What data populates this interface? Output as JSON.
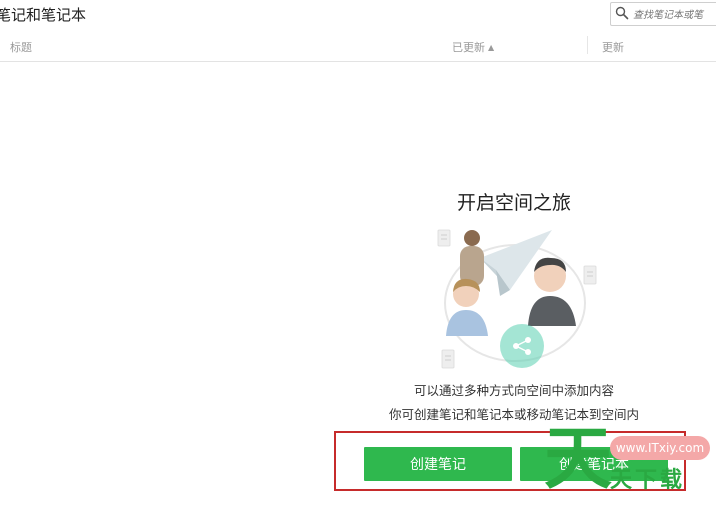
{
  "header": {
    "title": "笔记和笔记本",
    "search_placeholder": "查找笔记本或笔"
  },
  "table": {
    "columns": {
      "title": "标题",
      "updated": "已更新",
      "updated_sort_icon": "sort-up-arrow",
      "updated2": "更新"
    }
  },
  "empty_state": {
    "title": "开启空间之旅",
    "description_line1": "可以通过多种方式向空间中添加内容",
    "description_line2": "你可创建笔记和笔记本或移动笔记本到空间内",
    "illustration_icon": "people-paper-plane-share-illustration"
  },
  "actions": {
    "create_note": "创建笔记",
    "create_notebook": "创建笔记本",
    "highlight_color": "#c62b2b",
    "button_color": "#2fb84e"
  },
  "watermark": {
    "pill_text": "www.ITxiy.com",
    "big_char": "天",
    "small_text": "天下载",
    "color": "#2aa942"
  }
}
